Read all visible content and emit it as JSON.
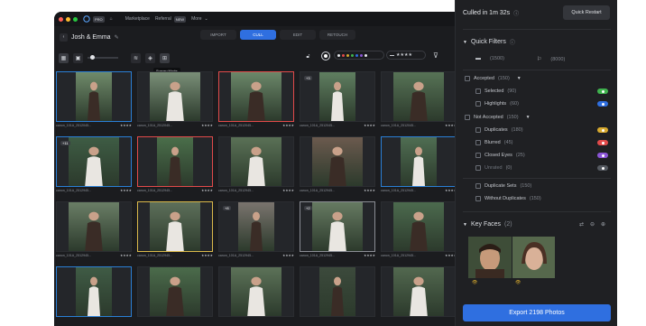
{
  "menubar": {
    "pro_badge": "PRO",
    "marketplace": "Marketplace",
    "referral": "Referral",
    "new_badge": "NEW",
    "more": "More"
  },
  "project": {
    "name": "Josh & Emma"
  },
  "tabs": [
    {
      "label": "IMPORT"
    },
    {
      "label": "CULL"
    },
    {
      "label": "EDIT"
    },
    {
      "label": "RETOUCH"
    }
  ],
  "toolbar": {
    "tooltip": "Survey Mode",
    "rating_filter": "★★★★"
  },
  "grid": {
    "items": [
      {
        "name": "canon_101A_2512045...",
        "stars": "★★★★",
        "border": "#2a7fd6",
        "badge": "",
        "bg": "#6f8a6a"
      },
      {
        "name": "canon_101A_2512045...",
        "stars": "★★★★",
        "border": "#2b2d31",
        "badge": "",
        "bg": "#7a8f78"
      },
      {
        "name": "canon_101A_2512045...",
        "stars": "★★★★",
        "border": "#e24a4a",
        "badge": "",
        "bg": "#6b8769"
      },
      {
        "name": "canon_101A_2512045...",
        "stars": "★★★★",
        "border": "#2b2d31",
        "badge": "+3",
        "bg": "#5f7e60"
      },
      {
        "name": "canon_101A_2512045...",
        "stars": "★★★★",
        "border": "#2b2d31",
        "badge": "",
        "bg": "#577356"
      },
      {
        "name": "canon_101A_2512945...",
        "stars": "★★★★",
        "border": "#2a7fd6",
        "badge": "+11",
        "bg": "#3e5c44"
      },
      {
        "name": "canon_101A_2512945...",
        "stars": "★★★★",
        "border": "#e24a4a",
        "badge": "",
        "bg": "#4a6e4a"
      },
      {
        "name": "canon_101A_2512945...",
        "stars": "★★★★",
        "border": "#2b2d31",
        "badge": "",
        "bg": "#5a7156"
      },
      {
        "name": "canon_101A_2512945...",
        "stars": "★★★★",
        "border": "#2b2d31",
        "badge": "",
        "bg": "#6b5a4e"
      },
      {
        "name": "canon_101A_2512945...",
        "stars": "★★★★",
        "border": "#2a7fd6",
        "badge": "",
        "bg": "#4f6d52"
      },
      {
        "name": "canon_101A_2512945...",
        "stars": "★★★★",
        "border": "#2b2d31",
        "badge": "",
        "bg": "#6a7e66"
      },
      {
        "name": "canon_101A_2512945...",
        "stars": "★★★★",
        "border": "#d9b84a",
        "badge": "",
        "bg": "#5d6f5a"
      },
      {
        "name": "canon_101A_2512945...",
        "stars": "★★★★",
        "border": "#2b2d31",
        "badge": "+8",
        "bg": "#7a746e"
      },
      {
        "name": "canon_101A_2512945...",
        "stars": "★★★★",
        "border": "#8a8d94",
        "badge": "+2",
        "bg": "#667a62"
      },
      {
        "name": "canon_101A_2512945...",
        "stars": "★★★★",
        "border": "#2b2d31",
        "badge": "",
        "bg": "#4c6a4e"
      },
      {
        "name": "",
        "stars": "",
        "border": "#2a7fd6",
        "badge": "",
        "bg": "#3f5b45"
      },
      {
        "name": "",
        "stars": "",
        "border": "#2b2d31",
        "badge": "",
        "bg": "#4b6b4b"
      },
      {
        "name": "",
        "stars": "",
        "border": "#2b2d31",
        "badge": "",
        "bg": "#5c7258"
      },
      {
        "name": "",
        "stars": "",
        "border": "#2b2d31",
        "badge": "",
        "bg": "#3c4a3c"
      },
      {
        "name": "",
        "stars": "",
        "border": "#2b2d31",
        "badge": "",
        "bg": "#52684f"
      }
    ]
  },
  "panel": {
    "culled_text": "Culled in 1m 32s",
    "quick_restart": "Quick Restart",
    "quick_filters": "Quick Filters",
    "folder_count": "(1500)",
    "flag_count": "(8000)",
    "accepted": {
      "label": "Accepted",
      "count": "(150)"
    },
    "selected": {
      "label": "Selected",
      "count": "(90)"
    },
    "highlights": {
      "label": "Highlights",
      "count": "(60)"
    },
    "not_accepted": {
      "label": "Not Accepted",
      "count": "(150)"
    },
    "duplicates": {
      "label": "Duplicates",
      "count": "(180)"
    },
    "blurred": {
      "label": "Blurred",
      "count": "(45)"
    },
    "closed_eyes": {
      "label": "Closed Eyes",
      "count": "(25)"
    },
    "unrated": {
      "label": "Unrated",
      "count": "(0)"
    },
    "duplicate_sets": {
      "label": "Duplicate Sets",
      "count": "(150)"
    },
    "without_duplicates": {
      "label": "Without Duplicates",
      "count": "(150)"
    },
    "key_faces": {
      "label": "Key Faces",
      "count": "(2)"
    },
    "export": "Export 2198 Photos",
    "chip_colors": {
      "selected": "#3fb24e",
      "highlights": "#2f6fe0",
      "duplicates": "#d6a92f",
      "blurred": "#e24a4a",
      "closed_eyes": "#8b55d6",
      "unrated": "#555a61"
    }
  }
}
